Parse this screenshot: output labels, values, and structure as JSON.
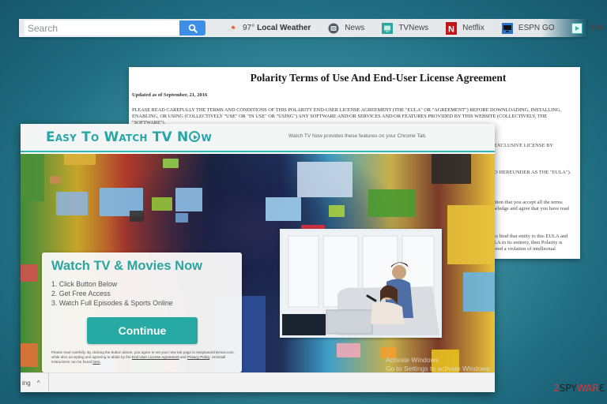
{
  "toolbar": {
    "search_placeholder": "Search",
    "search_icon": "search-icon",
    "weather": {
      "icon": "weather-cloud-sun-icon",
      "temp": "97°",
      "label": "Local Weather"
    },
    "links": [
      {
        "label": "News",
        "icon": "news-icon",
        "color": "#555a60"
      },
      {
        "label": "TVNews",
        "icon": "tvnews-icon",
        "color": "#2ba7a0"
      },
      {
        "label": "Netflix",
        "icon": "netflix-icon",
        "color": "#c0161b"
      },
      {
        "label": "ESPN GO",
        "icon": "espn-icon",
        "color": "#2a74c9"
      },
      {
        "label": "Hulu",
        "icon": "hulu-icon",
        "color": "#3fb3a8"
      }
    ]
  },
  "eula": {
    "title": "Polarity Terms of Use And End-User License Agreement",
    "updated": "Updated as of September, 21, 2016",
    "paragraph": "PLEASE READ CAREFULLY THE TERMS AND CONDITIONS OF THIS POLARITY END-USER LICENSE AGREEMENT (THE \"EULA\" OR \"AGREEMENT\") BEFORE DOWNLOADING, INSTALLING, ENABLING, OR USING (COLLECTIVELY \"USE\" OR \"IN USE\" OR \"USING\") ANY SOFTWARE AND/OR SERVICES AND/OR FEATURES PROVIDED BY THIS WEBSITE (COLLECTIVELY, THE \"SOFTWARE\").",
    "fragments": [
      "EXCLUSIVE LICENSE BY",
      "O HEREUNDER AS THE \"EULA\").",
      "ition that you accept all the terms",
      "wledge and agree that you have read",
      "to bind that entity to this EULA and",
      "LA in its entirety, then Polarity is",
      "ered a violation of intellectual"
    ]
  },
  "popup": {
    "logo": {
      "pre": "Easy To Watch TV N",
      "post": "w"
    },
    "header_note": "Watch TV Now provides these features on your Chrome Tab.",
    "card": {
      "title": "Watch TV & Movies Now",
      "steps": [
        "1. Click Button Below",
        "2. Get Free Access",
        "3. Watch Full Episodes & Sports Online"
      ],
      "button": "Continue",
      "fine_print": {
        "text1": "Please read carefully. By clicking the button above, you agree to set your new tab page to easytowatchtvnow.com, while also accepting and agreeing to abide by the ",
        "eula_link": "End User License Agreement",
        "and": " and ",
        "privacy_link": "Privacy Policy",
        "text2": ". Uninstall instructions can be found ",
        "here_link": "here",
        "end": "."
      }
    },
    "bottombar": {
      "download_label": "ing",
      "caret": "^",
      "activate_line1": "Activate Windows",
      "activate_line2": "Go to Settings to activate Windows."
    }
  },
  "watermark": {
    "prefix": "2",
    "mid": "SPY",
    "suffix": "WAR",
    "tail": "Ɛ"
  },
  "colors": {
    "accent_teal": "#27a9a4",
    "search_blue": "#3d8ee6",
    "brand_red": "#d33333"
  }
}
